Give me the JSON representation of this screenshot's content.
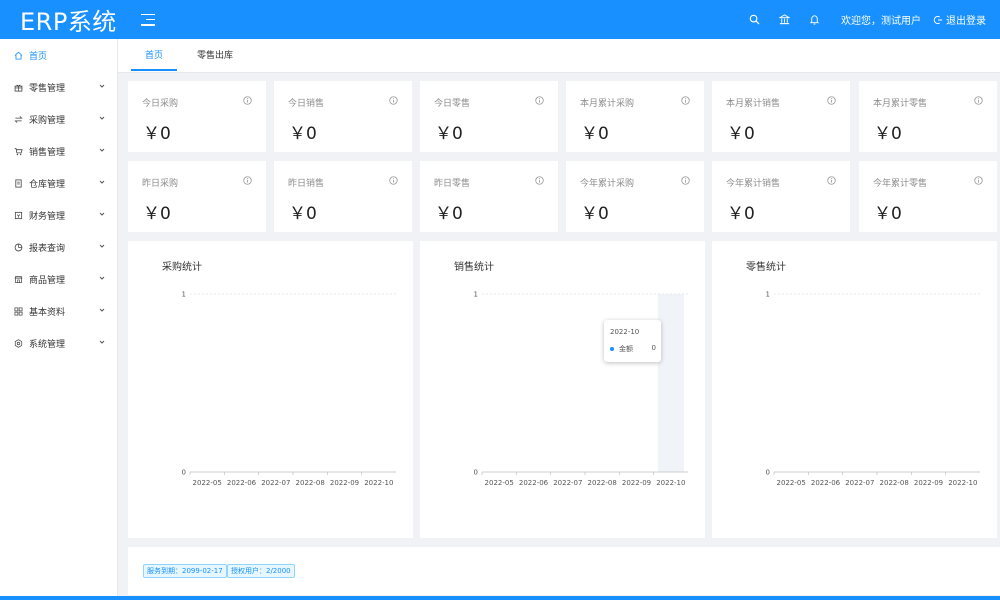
{
  "app": {
    "title": "ERP系统"
  },
  "header": {
    "welcome": "欢迎您，测试用户",
    "logout": "退出登录"
  },
  "sidebar": {
    "items": [
      {
        "label": "首页",
        "icon": "home-icon",
        "active": true,
        "expandable": false
      },
      {
        "label": "零售管理",
        "icon": "gift-icon",
        "expandable": true
      },
      {
        "label": "采购管理",
        "icon": "swap-icon",
        "expandable": true
      },
      {
        "label": "销售管理",
        "icon": "cart-icon",
        "expandable": true
      },
      {
        "label": "仓库管理",
        "icon": "book-icon",
        "expandable": true
      },
      {
        "label": "财务管理",
        "icon": "wallet-icon",
        "expandable": true
      },
      {
        "label": "报表查询",
        "icon": "pie-chart-icon",
        "expandable": true
      },
      {
        "label": "商品管理",
        "icon": "shop-icon",
        "expandable": true
      },
      {
        "label": "基本资料",
        "icon": "appstore-icon",
        "expandable": true
      },
      {
        "label": "系统管理",
        "icon": "setting-icon",
        "expandable": true
      }
    ]
  },
  "tabs": [
    {
      "label": "首页",
      "active": true
    },
    {
      "label": "零售出库",
      "active": false
    }
  ],
  "stats": [
    {
      "label": "今日采购",
      "value": "￥0"
    },
    {
      "label": "今日销售",
      "value": "￥0"
    },
    {
      "label": "今日零售",
      "value": "￥0"
    },
    {
      "label": "本月累计采购",
      "value": "￥0"
    },
    {
      "label": "本月累计销售",
      "value": "￥0"
    },
    {
      "label": "本月累计零售",
      "value": "￥0"
    },
    {
      "label": "昨日采购",
      "value": "￥0"
    },
    {
      "label": "昨日销售",
      "value": "￥0"
    },
    {
      "label": "昨日零售",
      "value": "￥0"
    },
    {
      "label": "今年累计采购",
      "value": "￥0"
    },
    {
      "label": "今年累计销售",
      "value": "￥0"
    },
    {
      "label": "今年累计零售",
      "value": "￥0"
    }
  ],
  "charts": {
    "purchase_title": "采购统计",
    "sales_title": "销售统计",
    "retail_title": "零售统计"
  },
  "tooltip": {
    "title": "2022-10",
    "series": "金额",
    "value": "0"
  },
  "chart_data": [
    {
      "type": "bar",
      "title": "采购统计",
      "categories": [
        "2022-05",
        "2022-06",
        "2022-07",
        "2022-08",
        "2022-09",
        "2022-10"
      ],
      "values": [
        0,
        0,
        0,
        0,
        0,
        0
      ],
      "ylim": [
        0,
        1
      ],
      "yticks": [
        "0",
        "1"
      ]
    },
    {
      "type": "bar",
      "title": "销售统计",
      "categories": [
        "2022-05",
        "2022-06",
        "2022-07",
        "2022-08",
        "2022-09",
        "2022-10"
      ],
      "series": [
        {
          "name": "金额",
          "values": [
            0,
            0,
            0,
            0,
            0,
            0
          ]
        }
      ],
      "ylim": [
        0,
        1
      ],
      "yticks": [
        "0",
        "1"
      ],
      "highlighted": "2022-10"
    },
    {
      "type": "bar",
      "title": "零售统计",
      "categories": [
        "2022-05",
        "2022-06",
        "2022-07",
        "2022-08",
        "2022-09",
        "2022-10"
      ],
      "values": [
        0,
        0,
        0,
        0,
        0,
        0
      ],
      "ylim": [
        0,
        1
      ],
      "yticks": [
        "0",
        "1"
      ]
    }
  ],
  "footer": {
    "service_expiry": "服务到期：2099-02-17",
    "licensed_users": "授权用户：2/2000"
  },
  "colors": {
    "primary": "#1890ff",
    "background": "#f0f2f5",
    "highlight": "#f0f3f8"
  }
}
